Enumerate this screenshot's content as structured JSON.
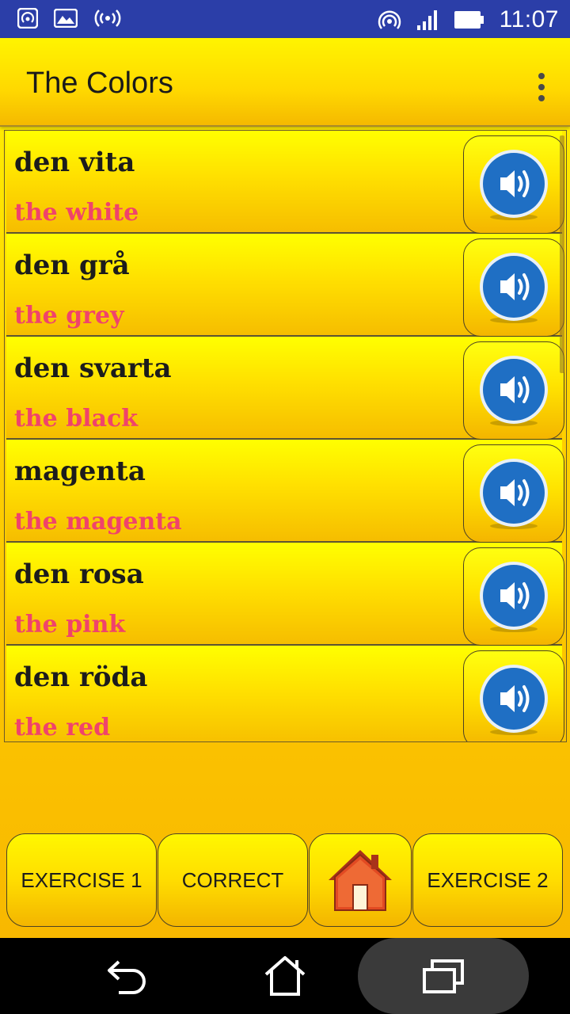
{
  "status_bar": {
    "time": "11:07"
  },
  "app_bar": {
    "title": "The Colors"
  },
  "list": [
    {
      "word": "den vita",
      "translation": "the white"
    },
    {
      "word": "den grå",
      "translation": "the grey"
    },
    {
      "word": "den svarta",
      "translation": "the black"
    },
    {
      "word": "magenta",
      "translation": "the magenta"
    },
    {
      "word": "den rosa",
      "translation": "the pink"
    },
    {
      "word": "den röda",
      "translation": "the red"
    }
  ],
  "buttons": {
    "exercise1": "EXERCISE 1",
    "correct": "CORRECT",
    "exercise2": "EXERCISE 2"
  },
  "icons": {
    "speaker": "speaker-icon",
    "home": "home-icon",
    "back": "back-icon",
    "nav_home": "nav-home-icon",
    "recents": "recents-icon"
  },
  "colors": {
    "status_bar": "#2b3ea8",
    "translation_text": "#f0436b",
    "speaker_blue": "#1f6fc4"
  }
}
